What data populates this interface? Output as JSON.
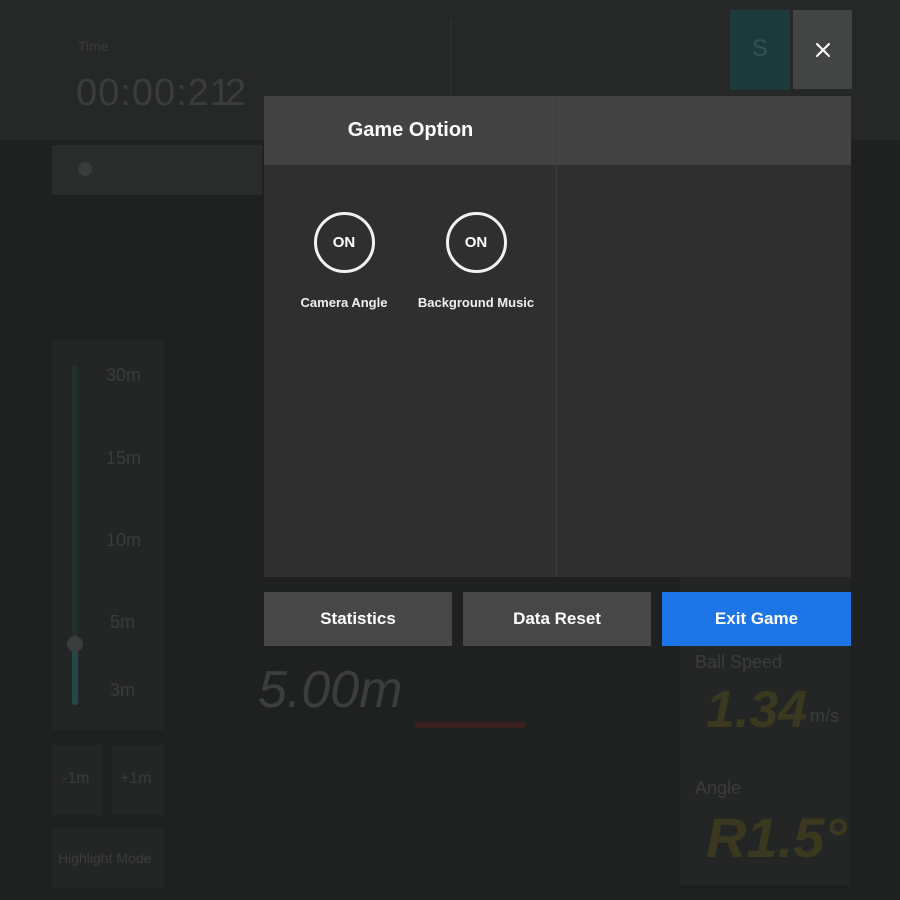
{
  "background": {
    "timer_label": "Time",
    "timer_value": "00:00:21",
    "timer_extra": "2",
    "teal_box": "S",
    "gauge_ticks": [
      "30m",
      "15m",
      "10m",
      "5m",
      "3m"
    ],
    "step_buttons": [
      "-1m",
      "+1m"
    ],
    "bottom_left_button": "Highlight Mode",
    "distance": "5.00m",
    "ball_speed_label": "Ball Speed",
    "ball_speed_value": "1.34",
    "ball_speed_unit": "m/s",
    "angle_label": "Angle",
    "angle_value": "R1.5°"
  },
  "close": {
    "icon": "close-icon"
  },
  "modal": {
    "title": "Game Option",
    "toggles": [
      {
        "state": "ON",
        "label": "Camera Angle"
      },
      {
        "state": "ON",
        "label": "Background Music"
      }
    ]
  },
  "buttons": {
    "statistics": "Statistics",
    "data_reset": "Data Reset",
    "exit_game": "Exit Game"
  },
  "colors": {
    "accent": "#1d74e6",
    "modal_bg": "#2f2f2f",
    "header_bg": "#434343"
  }
}
